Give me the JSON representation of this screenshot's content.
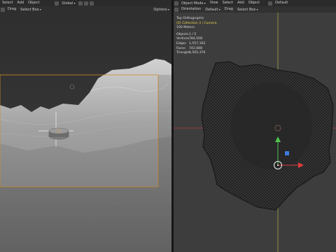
{
  "left_viewport": {
    "menu": [
      "Select",
      "Add",
      "Object"
    ],
    "orientation_value": "Global",
    "drag_label": "Drag",
    "select_mode": "Select Box",
    "options_label": "Options"
  },
  "right_viewport": {
    "mode": "Object Mode",
    "menu": [
      "View",
      "Select",
      "Add",
      "Object"
    ],
    "orientation_label": "Orientation",
    "orientation_value": "Default",
    "drag_label": "Drag",
    "select_mode": "Select Box",
    "view_name": "Top Orthographic",
    "collection_path": "(0) Collection 3 | Camera",
    "scale": "100 Meters",
    "stats": [
      {
        "label": "Objects",
        "value": "1 / 5"
      },
      {
        "label": "Vertices",
        "value": "784,508"
      },
      {
        "label": "Edges",
        "value": "1,557,162"
      },
      {
        "label": "Faces",
        "value": "742,688"
      },
      {
        "label": "Triangles",
        "value": "1,565,376"
      }
    ]
  },
  "colors": {
    "camera_frame": "#d08a2a",
    "axis_x": "#d23a3a",
    "axis_y": "#b8c040",
    "gizmo_y": "#4fc24f",
    "gizmo_x": "#e03c3c",
    "gizmo_z": "#3d7ae0"
  }
}
